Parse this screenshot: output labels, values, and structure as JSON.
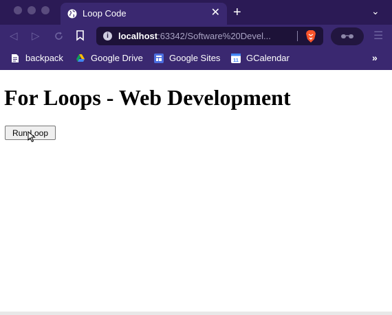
{
  "browser": {
    "tab": {
      "title": "Loop Code",
      "close": "✕"
    },
    "new_tab": "+",
    "tab_menu": "⌄",
    "address": {
      "host": "localhost",
      "rest": ":63342/Software%20Devel..."
    },
    "bookmarks": [
      {
        "label": "backpack",
        "icon": "page-icon"
      },
      {
        "label": "Google Drive",
        "icon": "google-drive-icon"
      },
      {
        "label": "Google Sites",
        "icon": "google-sites-icon"
      },
      {
        "label": "GCalendar",
        "icon": "calendar-icon"
      }
    ],
    "bookmarks_more": "»",
    "calendar_day": "11"
  },
  "page": {
    "heading": "For Loops - Web Development",
    "run_button": "Run Loop"
  }
}
